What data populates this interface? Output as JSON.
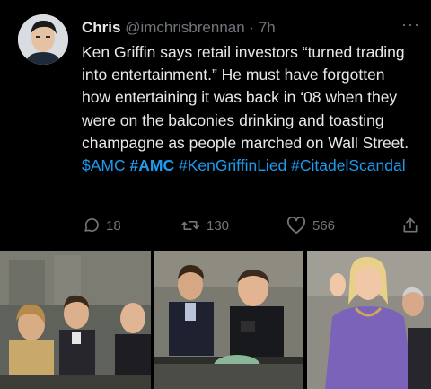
{
  "tweet": {
    "author_name": "Chris",
    "author_handle": "@imchrisbrennan",
    "separator": "·",
    "time": "7h",
    "more_glyph": "···",
    "lines": [
      "Ken Griffin says retail investors “turned trading",
      "into entertainment.” He must have forgotten",
      "how entertaining it was back in ‘08 when they",
      "were on the balconies drinking and toasting",
      "champagne as people marched on Wall Street."
    ],
    "hashtags": [
      "$AMC",
      "#AMC",
      "#KenGriffinLied",
      "#CitadelScandal"
    ]
  },
  "actions": {
    "reply_count": "18",
    "retweet_count": "130",
    "like_count": "566"
  },
  "icons": {
    "reply": "reply-icon",
    "retweet": "retweet-icon",
    "like": "heart-icon",
    "share": "share-icon",
    "more": "more-icon"
  },
  "colors": {
    "background": "#000000",
    "text": "#e7e9ea",
    "muted": "#71767b",
    "link": "#1d9bf0"
  }
}
